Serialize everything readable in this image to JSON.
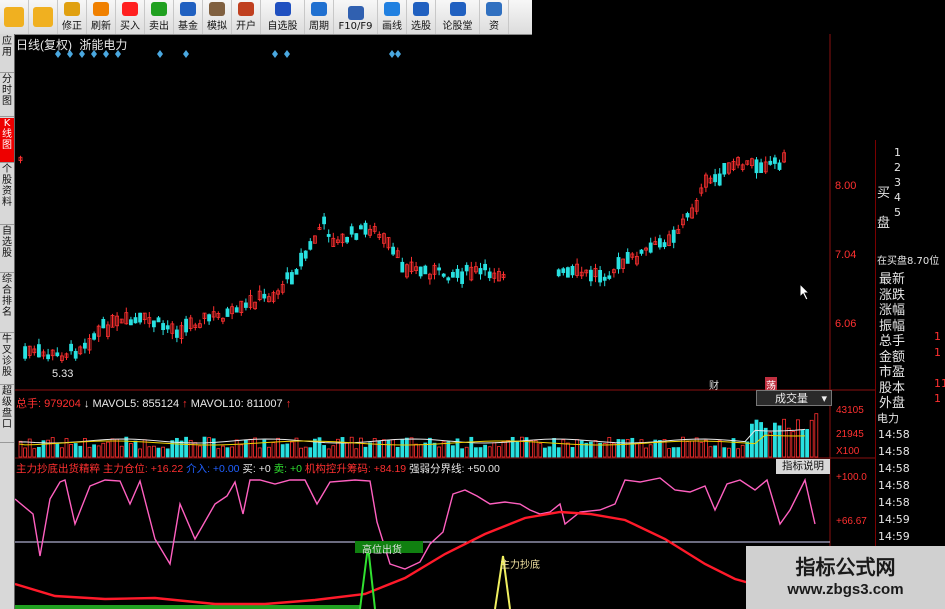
{
  "toolbar": {
    "buttons": [
      {
        "label": "",
        "icon": "back-arrow-icon",
        "color": "#f0b020"
      },
      {
        "label": "",
        "icon": "forward-arrow-icon",
        "color": "#f0b020"
      },
      {
        "label": "修正",
        "icon": "lock-icon",
        "color": "#e0a010"
      },
      {
        "label": "刷新",
        "icon": "clock-icon",
        "color": "#f08000"
      },
      {
        "label": "买入",
        "icon": "buy-icon",
        "color": "#ff2020"
      },
      {
        "label": "卖出",
        "icon": "sell-icon",
        "color": "#20a020"
      },
      {
        "label": "基金",
        "icon": "fund-icon",
        "color": "#2060c0"
      },
      {
        "label": "模拟",
        "icon": "hammer-icon",
        "color": "#806040"
      },
      {
        "label": "开户",
        "icon": "account-icon",
        "color": "#c04020"
      },
      {
        "label": "自选股",
        "icon": "watchlist-icon",
        "color": "#2050c0"
      },
      {
        "label": "周期",
        "icon": "period-icon",
        "color": "#2070d0"
      },
      {
        "label": "F10/F9",
        "icon": "f10-icon",
        "color": "#3060b0"
      },
      {
        "label": "画线",
        "icon": "pen-icon",
        "color": "#2080e0"
      },
      {
        "label": "选股",
        "icon": "select-icon",
        "color": "#2060c0"
      },
      {
        "label": "论股堂",
        "icon": "forum-icon",
        "color": "#2060c0"
      },
      {
        "label": "资",
        "icon": "info-icon",
        "color": "#3070c0"
      }
    ]
  },
  "left_tabs": [
    "应用",
    "分时图",
    "K线图",
    "个股资料",
    "自选股",
    "综合排名",
    "牛叉诊股",
    "超级盘口"
  ],
  "chart_header": {
    "mode": "日线(复权)",
    "stock": "浙能电力"
  },
  "price_axis": {
    "ticks": [
      "8.00",
      "7.04",
      "6.06"
    ]
  },
  "low_label": "5.33",
  "markers": {
    "cai": "财",
    "tu": "荡"
  },
  "volume_bar": {
    "total": "总手: 979204",
    "mavol5": "MAVOL5: 855124",
    "mavol10": "MAVOL10: 811007",
    "dropdown": "成交量",
    "ticks": [
      "43105",
      "21945",
      "X100"
    ]
  },
  "indicator_bar": {
    "name": "主力抄底出货精粹",
    "pos": "主力仓位: +16.22",
    "jin": "介入: +0.00",
    "buy": "买: +0",
    "sell": "卖: +0",
    "inst": "机构控升筹码: +84.19",
    "strong": "强弱分界线: +50.00",
    "help": "指标说明",
    "ticks": [
      "+100.0",
      "+66.67"
    ],
    "sell_signal": "高位出货",
    "buy_signal": "主力抄底"
  },
  "right_panel": {
    "sell_label": "买",
    "sell_label2": "盘",
    "nums": [
      "1",
      "2",
      "3",
      "4",
      "5"
    ],
    "bid_row": "在买盘8.70位",
    "fields": [
      "最新",
      "涨跌",
      "涨幅",
      "振幅",
      "总手",
      "金额",
      "市盈",
      "股本",
      "外盘"
    ],
    "field_vals": [
      "",
      "",
      "",
      "",
      "1",
      "1",
      "",
      "11",
      "1"
    ],
    "section": "电力",
    "times": [
      "14:58",
      "14:58",
      "14:58",
      "14:58",
      "14:58",
      "14:59",
      "14:59"
    ]
  },
  "watermark": {
    "line1": "指标公式网",
    "line2": "www.zbgs3.com"
  },
  "colors": {
    "up": "#ff3030",
    "down": "#28e0e0",
    "pink": "#ff60c0",
    "red_line": "#ff1a2a"
  }
}
